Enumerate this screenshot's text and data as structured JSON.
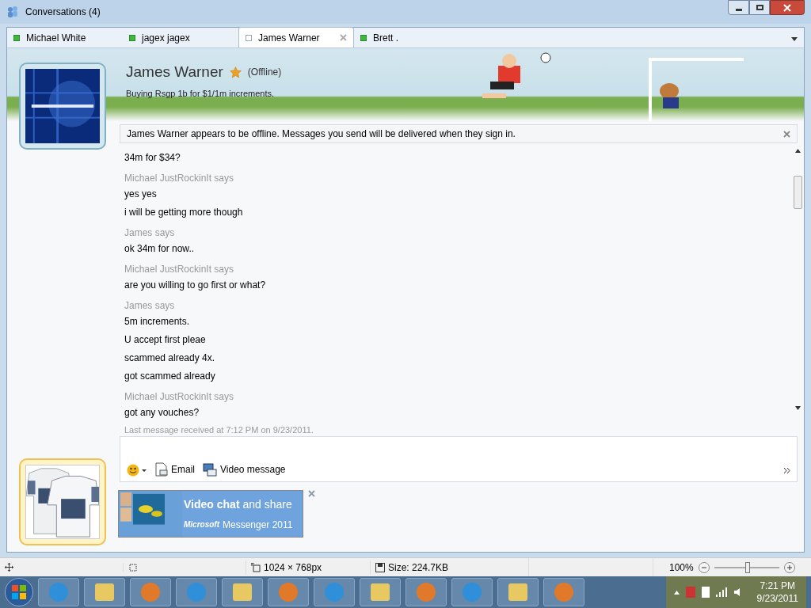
{
  "window": {
    "title": "Conversations (4)"
  },
  "tabs": [
    {
      "label": "Michael White",
      "selected": false,
      "online": true
    },
    {
      "label": "jagex jagex",
      "selected": false,
      "online": true
    },
    {
      "label": "James Warner",
      "selected": true,
      "online": false
    },
    {
      "label": "Brett .",
      "selected": false,
      "online": true
    }
  ],
  "contact": {
    "name": "James Warner",
    "favorite": true,
    "status": "(Offline)",
    "personal_message": "Buying Rsgp 1b for $1/1m increments."
  },
  "info_bar": {
    "text": "James Warner appears to be offline. Messages you send will be delivered when they sign in."
  },
  "messages": [
    {
      "kind": "line",
      "text": "34m for $34?"
    },
    {
      "kind": "sender",
      "text": "Michael JustRockinIt says"
    },
    {
      "kind": "line",
      "text": "yes yes"
    },
    {
      "kind": "line",
      "text": "i will be getting more though"
    },
    {
      "kind": "sender",
      "text": "James says"
    },
    {
      "kind": "line",
      "text": "ok 34m for now.."
    },
    {
      "kind": "sender",
      "text": "Michael JustRockinIt says"
    },
    {
      "kind": "line",
      "text": "are you willing to go first or what?"
    },
    {
      "kind": "sender",
      "text": "James says"
    },
    {
      "kind": "line",
      "text": "5m increments."
    },
    {
      "kind": "line",
      "text": "U accept first pleae"
    },
    {
      "kind": "line",
      "text": "scammed already 4x."
    },
    {
      "kind": "line",
      "text": "got scammed already"
    },
    {
      "kind": "sender",
      "text": "Michael JustRockinIt says"
    },
    {
      "kind": "line",
      "text": "got any vouches?"
    }
  ],
  "last_message": "Last message received at 7:12 PM on 9/23/2011.",
  "toolbar": [
    {
      "kind": "emoticon"
    },
    {
      "kind": "email",
      "label": "Email"
    },
    {
      "kind": "video",
      "label": "Video message"
    }
  ],
  "ad": {
    "headline_bold": "Video chat",
    "headline": "and share",
    "brand": "Microsoft",
    "product": "Messenger 2011"
  },
  "viewer_status": {
    "dimensions": "1024 × 768px",
    "size": "Size: 224.7KB",
    "zoom": "100%",
    "zoom_slider": {
      "level": 0.52
    }
  },
  "taskbar": {
    "time": "7:21 PM",
    "date": "9/23/2011"
  }
}
